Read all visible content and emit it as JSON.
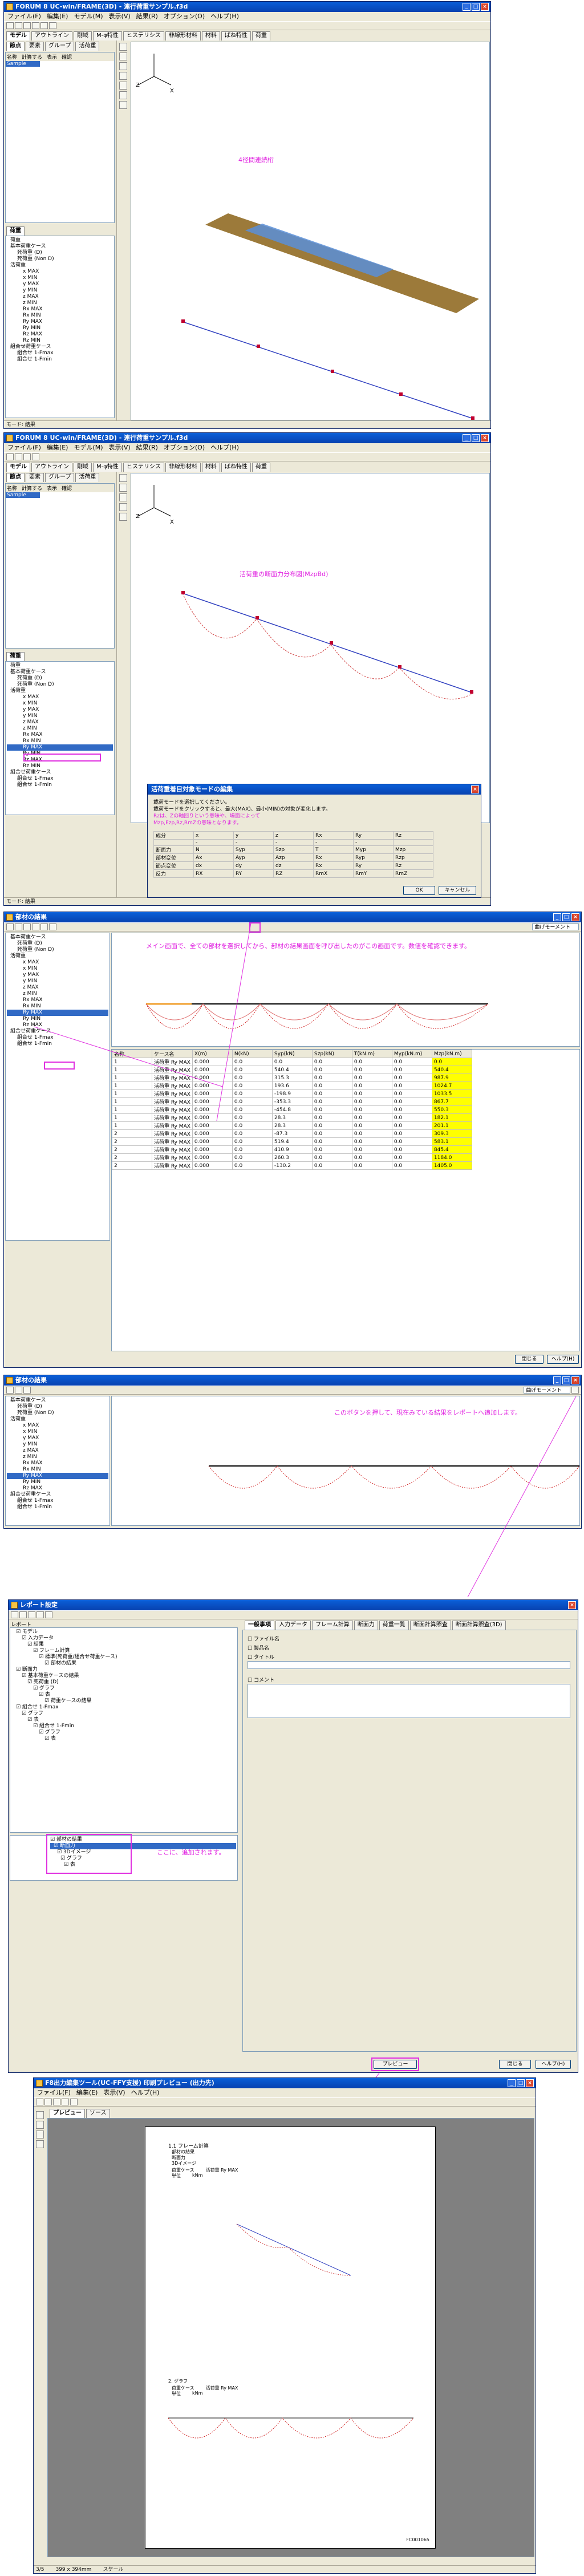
{
  "app": {
    "title": "FORUM 8  UC-win/FRAME(3D) - 連行荷重サンプル.f3d",
    "menu": [
      "ファイル(F)",
      "編集(E)",
      "モデル(M)",
      "表示(V)",
      "結果(R)",
      "オプション(O)",
      "ヘルプ(H)"
    ],
    "tabs": [
      "モデル",
      "アウトライン",
      "剛域",
      "M-φ特性",
      "ヒステリシス",
      "非線形材料",
      "材料",
      "ばね特性",
      "荷重"
    ],
    "side_tabs": [
      "節点",
      "要素",
      "グループ",
      "活荷重"
    ],
    "list_headers": [
      "名称",
      "計算する",
      "表示",
      "確認"
    ],
    "list_row": "Sample",
    "lower_tab": "荷重",
    "status": "モード: 結果"
  },
  "tree_1": [
    "荷重",
    "基本荷重ケース",
    "死荷重 (D)",
    "死荷重 (Non D)",
    "活荷重",
    "x MAX",
    "x MIN",
    "y MAX",
    "y MIN",
    "z MAX",
    "z MIN",
    "Rx MAX",
    "Rx MIN",
    "Ry MAX",
    "Ry MIN",
    "Rz MAX",
    "Rz MIN",
    "組合せ荷重ケース",
    "組合せ 1-Fmax",
    "組合せ 1-Fmin"
  ],
  "tree_2": [
    "荷重",
    "基本荷重ケース",
    "死荷重 (D)",
    "死荷重 (Non D)",
    "活荷重",
    "x MAX",
    "x MIN",
    "y MAX",
    "y MIN",
    "z MAX",
    "z MIN",
    "Rx MAX",
    "Rx MIN",
    "Ry MAX",
    "Ry MIN",
    "Rz MAX",
    "Rz MIN",
    "組合せ荷重ケース",
    "組合せ 1-Fmax",
    "組合せ 1-Fmin"
  ],
  "tree_2_selected": "Ry MAX",
  "tree_3": [
    "基本荷重ケース",
    "死荷重 (D)",
    "死荷重 (Non D)",
    "活荷重",
    "x MAX",
    "x MIN",
    "y MAX",
    "y MIN",
    "z MAX",
    "z MIN",
    "Rx MAX",
    "Rx MIN",
    "Ry MAX",
    "Ry MIN",
    "Rz MAX",
    "組合せ荷重ケース",
    "組合せ 1-Fmax",
    "組合せ 1-Fmin"
  ],
  "tree_3_selected": "Ry MAX",
  "tree_4": [
    "基本荷重ケース",
    "死荷重 (D)",
    "死荷重 (Non D)",
    "活荷重",
    "x MAX",
    "x MIN",
    "y MAX",
    "y MIN",
    "z MAX",
    "z MIN",
    "Rx MAX",
    "Rx MIN",
    "Ry MAX",
    "Ry MIN",
    "Rz MAX",
    "組合せ荷重ケース",
    "組合せ 1-Fmax",
    "組合せ 1-Fmin"
  ],
  "tree_4_selected": "Ry MAX",
  "view_dropdown": "曲げモーメント",
  "view_dropdown_alt": "部材力(MzpBd)",
  "notes": {
    "n1": "4径間連続桁",
    "n2": "活荷重の断面力分布図(MzpBd)",
    "n3": "メイン画面で、全ての部材を選択してから、部材の結果画面を呼び出したのがこの画面です。数値を確認できます。",
    "n4": "このボタンを押して、現在みている結果をレポートへ追加します。",
    "n5": "ここに、追加されます。"
  },
  "dialog_1": {
    "title": "活荷重着目対象モードの編集",
    "line1": "載荷モードを選択してください。",
    "line2": "載荷モードをクリックすると、最大(MAX)、最小(MIN)の対象が変化します。",
    "pink": "Rzは、Zの軸回りという意味や、場面によってMzp,Ezp,Rz,RmZの意味となります。",
    "headers": [
      "成分",
      "x",
      "y",
      "z",
      "Rx",
      "Ry",
      "Rz"
    ],
    "rows": [
      [
        "",
        "-",
        "-",
        "-",
        "-",
        "-",
        ""
      ],
      [
        "断面力",
        "N",
        "Syp",
        "Szp",
        "T",
        "Myp",
        "Mzp"
      ],
      [
        "部材変位",
        "Ax",
        "Ayp",
        "Azp",
        "Rx",
        "Ryp",
        "Rzp"
      ],
      [
        "節点変位",
        "dx",
        "dy",
        "dz",
        "Rx",
        "Ry",
        "Rz"
      ],
      [
        "反力",
        "RX",
        "RY",
        "RZ",
        "RmX",
        "RmY",
        "RmZ"
      ]
    ],
    "ok": "OK",
    "cancel": "キャンセル"
  },
  "table": {
    "headers": [
      "名称",
      "ケース名",
      "X(m)",
      "N(kN)",
      "Syp(kN)",
      "Szp(kN)",
      "T(kN.m)",
      "Myp(kN.m)",
      "Mzp(kN.m)"
    ],
    "rows": [
      [
        "1",
        "活荷重 Ry MAX",
        "0.000",
        "0.0",
        "0.0",
        "0.0",
        "0.0",
        "0.0",
        "0.0"
      ],
      [
        "1",
        "活荷重 Ry MAX",
        "0.000",
        "0.0",
        "540.4",
        "0.0",
        "0.0",
        "0.0",
        "540.4"
      ],
      [
        "1",
        "活荷重 Ry MAX",
        "0.000",
        "0.0",
        "315.3",
        "0.0",
        "0.0",
        "0.0",
        "987.9"
      ],
      [
        "1",
        "活荷重 Ry MAX",
        "0.000",
        "0.0",
        "193.6",
        "0.0",
        "0.0",
        "0.0",
        "1024.7"
      ],
      [
        "1",
        "活荷重 Ry MAX",
        "0.000",
        "0.0",
        "-198.9",
        "0.0",
        "0.0",
        "0.0",
        "1033.5"
      ],
      [
        "1",
        "活荷重 Ry MAX",
        "0.000",
        "0.0",
        "-353.3",
        "0.0",
        "0.0",
        "0.0",
        "867.7"
      ],
      [
        "1",
        "活荷重 Ry MAX",
        "0.000",
        "0.0",
        "-454.8",
        "0.0",
        "0.0",
        "0.0",
        "550.3"
      ],
      [
        "1",
        "活荷重 Ry MAX",
        "0.000",
        "0.0",
        "28.3",
        "0.0",
        "0.0",
        "0.0",
        "182.1"
      ],
      [
        "1",
        "活荷重 Ry MAX",
        "0.000",
        "0.0",
        "28.3",
        "0.0",
        "0.0",
        "0.0",
        "201.1"
      ],
      [
        "2",
        "活荷重 Ry MAX",
        "0.000",
        "0.0",
        "-87.3",
        "0.0",
        "0.0",
        "0.0",
        "309.3"
      ],
      [
        "2",
        "活荷重 Ry MAX",
        "0.000",
        "0.0",
        "519.4",
        "0.0",
        "0.0",
        "0.0",
        "583.1"
      ],
      [
        "2",
        "活荷重 Ry MAX",
        "0.000",
        "0.0",
        "410.9",
        "0.0",
        "0.0",
        "0.0",
        "845.4"
      ],
      [
        "2",
        "活荷重 Ry MAX",
        "0.000",
        "0.0",
        "260.3",
        "0.0",
        "0.0",
        "0.0",
        "1184.0"
      ],
      [
        "2",
        "活荷重 Ry MAX",
        "0.000",
        "0.0",
        "-130.2",
        "0.0",
        "0.0",
        "0.0",
        "1405.0"
      ]
    ],
    "close": "閉じる",
    "help": "ヘルプ(H)"
  },
  "win3_title": "部材の結果",
  "win4_title": "部材の結果",
  "report": {
    "title": "レポート設定",
    "label": "レポート",
    "tree": [
      "モデル",
      "入力データ",
      "結果",
      "フレーム計算",
      "標準(死荷重/組合せ荷重ケース)",
      "部材の結果",
      "断面力",
      "基本荷重ケースの結果",
      "死荷重 (D)",
      "グラフ",
      "表",
      "荷重ケースの結果",
      "組合せ 1-Fmax",
      "グラフ",
      "表",
      "組合せ 1-Fmin",
      "グラフ",
      "表"
    ],
    "tree_added": [
      "部材の結果",
      "断面力",
      "3Dイメージ",
      "グラフ",
      "表"
    ],
    "tabs": [
      "一般事項",
      "入力データ",
      "フレーム計算",
      "断面力",
      "荷重一覧",
      "断面計算照査",
      "断面計算照査(3D)"
    ],
    "fields": [
      "ファイル名",
      "製品名",
      "タイトル",
      "コメント"
    ],
    "preview": "プレビュー",
    "close": "閉じる",
    "help": "ヘルプ(H)"
  },
  "preview": {
    "title": "F8出力編集ツール(UC-FFY支援) 印刷プレビュー (出力先)",
    "menu": [
      "ファイル(F)",
      "編集(E)",
      "表示(V)",
      "ヘルプ(H)"
    ],
    "tabs": [
      "プレビュー",
      "ソース"
    ],
    "heading": "1.1 フレーム計算",
    "items": [
      "部材の結果",
      "断面力",
      "3Dイメージ",
      "荷重ケース",
      "単位"
    ],
    "case": "活荷重 Ry MAX",
    "unit": "kNm",
    "item2": "2. グラフ",
    "page_no": "3/5",
    "footer": "FC001065",
    "zoom": "399 x 394mm",
    "status": "スケール"
  }
}
